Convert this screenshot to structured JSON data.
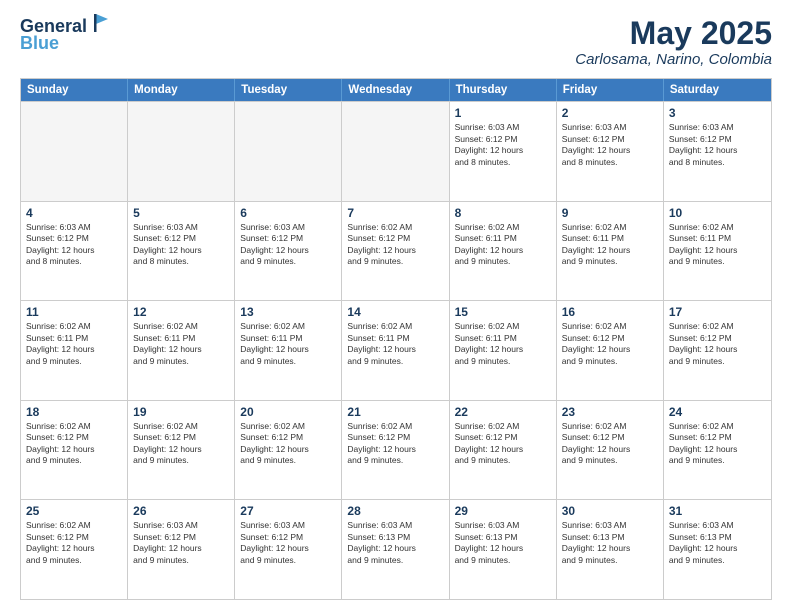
{
  "header": {
    "logo_line1": "General",
    "logo_line2": "Blue",
    "month_title": "May 2025",
    "location": "Carlosama, Narino, Colombia"
  },
  "weekdays": [
    "Sunday",
    "Monday",
    "Tuesday",
    "Wednesday",
    "Thursday",
    "Friday",
    "Saturday"
  ],
  "rows": [
    [
      {
        "day": "",
        "text": "",
        "empty": true
      },
      {
        "day": "",
        "text": "",
        "empty": true
      },
      {
        "day": "",
        "text": "",
        "empty": true
      },
      {
        "day": "",
        "text": "",
        "empty": true
      },
      {
        "day": "1",
        "text": "Sunrise: 6:03 AM\nSunset: 6:12 PM\nDaylight: 12 hours\nand 8 minutes.",
        "empty": false
      },
      {
        "day": "2",
        "text": "Sunrise: 6:03 AM\nSunset: 6:12 PM\nDaylight: 12 hours\nand 8 minutes.",
        "empty": false
      },
      {
        "day": "3",
        "text": "Sunrise: 6:03 AM\nSunset: 6:12 PM\nDaylight: 12 hours\nand 8 minutes.",
        "empty": false
      }
    ],
    [
      {
        "day": "4",
        "text": "Sunrise: 6:03 AM\nSunset: 6:12 PM\nDaylight: 12 hours\nand 8 minutes.",
        "empty": false
      },
      {
        "day": "5",
        "text": "Sunrise: 6:03 AM\nSunset: 6:12 PM\nDaylight: 12 hours\nand 8 minutes.",
        "empty": false
      },
      {
        "day": "6",
        "text": "Sunrise: 6:03 AM\nSunset: 6:12 PM\nDaylight: 12 hours\nand 9 minutes.",
        "empty": false
      },
      {
        "day": "7",
        "text": "Sunrise: 6:02 AM\nSunset: 6:12 PM\nDaylight: 12 hours\nand 9 minutes.",
        "empty": false
      },
      {
        "day": "8",
        "text": "Sunrise: 6:02 AM\nSunset: 6:11 PM\nDaylight: 12 hours\nand 9 minutes.",
        "empty": false
      },
      {
        "day": "9",
        "text": "Sunrise: 6:02 AM\nSunset: 6:11 PM\nDaylight: 12 hours\nand 9 minutes.",
        "empty": false
      },
      {
        "day": "10",
        "text": "Sunrise: 6:02 AM\nSunset: 6:11 PM\nDaylight: 12 hours\nand 9 minutes.",
        "empty": false
      }
    ],
    [
      {
        "day": "11",
        "text": "Sunrise: 6:02 AM\nSunset: 6:11 PM\nDaylight: 12 hours\nand 9 minutes.",
        "empty": false
      },
      {
        "day": "12",
        "text": "Sunrise: 6:02 AM\nSunset: 6:11 PM\nDaylight: 12 hours\nand 9 minutes.",
        "empty": false
      },
      {
        "day": "13",
        "text": "Sunrise: 6:02 AM\nSunset: 6:11 PM\nDaylight: 12 hours\nand 9 minutes.",
        "empty": false
      },
      {
        "day": "14",
        "text": "Sunrise: 6:02 AM\nSunset: 6:11 PM\nDaylight: 12 hours\nand 9 minutes.",
        "empty": false
      },
      {
        "day": "15",
        "text": "Sunrise: 6:02 AM\nSunset: 6:11 PM\nDaylight: 12 hours\nand 9 minutes.",
        "empty": false
      },
      {
        "day": "16",
        "text": "Sunrise: 6:02 AM\nSunset: 6:12 PM\nDaylight: 12 hours\nand 9 minutes.",
        "empty": false
      },
      {
        "day": "17",
        "text": "Sunrise: 6:02 AM\nSunset: 6:12 PM\nDaylight: 12 hours\nand 9 minutes.",
        "empty": false
      }
    ],
    [
      {
        "day": "18",
        "text": "Sunrise: 6:02 AM\nSunset: 6:12 PM\nDaylight: 12 hours\nand 9 minutes.",
        "empty": false
      },
      {
        "day": "19",
        "text": "Sunrise: 6:02 AM\nSunset: 6:12 PM\nDaylight: 12 hours\nand 9 minutes.",
        "empty": false
      },
      {
        "day": "20",
        "text": "Sunrise: 6:02 AM\nSunset: 6:12 PM\nDaylight: 12 hours\nand 9 minutes.",
        "empty": false
      },
      {
        "day": "21",
        "text": "Sunrise: 6:02 AM\nSunset: 6:12 PM\nDaylight: 12 hours\nand 9 minutes.",
        "empty": false
      },
      {
        "day": "22",
        "text": "Sunrise: 6:02 AM\nSunset: 6:12 PM\nDaylight: 12 hours\nand 9 minutes.",
        "empty": false
      },
      {
        "day": "23",
        "text": "Sunrise: 6:02 AM\nSunset: 6:12 PM\nDaylight: 12 hours\nand 9 minutes.",
        "empty": false
      },
      {
        "day": "24",
        "text": "Sunrise: 6:02 AM\nSunset: 6:12 PM\nDaylight: 12 hours\nand 9 minutes.",
        "empty": false
      }
    ],
    [
      {
        "day": "25",
        "text": "Sunrise: 6:02 AM\nSunset: 6:12 PM\nDaylight: 12 hours\nand 9 minutes.",
        "empty": false
      },
      {
        "day": "26",
        "text": "Sunrise: 6:03 AM\nSunset: 6:12 PM\nDaylight: 12 hours\nand 9 minutes.",
        "empty": false
      },
      {
        "day": "27",
        "text": "Sunrise: 6:03 AM\nSunset: 6:12 PM\nDaylight: 12 hours\nand 9 minutes.",
        "empty": false
      },
      {
        "day": "28",
        "text": "Sunrise: 6:03 AM\nSunset: 6:13 PM\nDaylight: 12 hours\nand 9 minutes.",
        "empty": false
      },
      {
        "day": "29",
        "text": "Sunrise: 6:03 AM\nSunset: 6:13 PM\nDaylight: 12 hours\nand 9 minutes.",
        "empty": false
      },
      {
        "day": "30",
        "text": "Sunrise: 6:03 AM\nSunset: 6:13 PM\nDaylight: 12 hours\nand 9 minutes.",
        "empty": false
      },
      {
        "day": "31",
        "text": "Sunrise: 6:03 AM\nSunset: 6:13 PM\nDaylight: 12 hours\nand 9 minutes.",
        "empty": false
      }
    ]
  ]
}
